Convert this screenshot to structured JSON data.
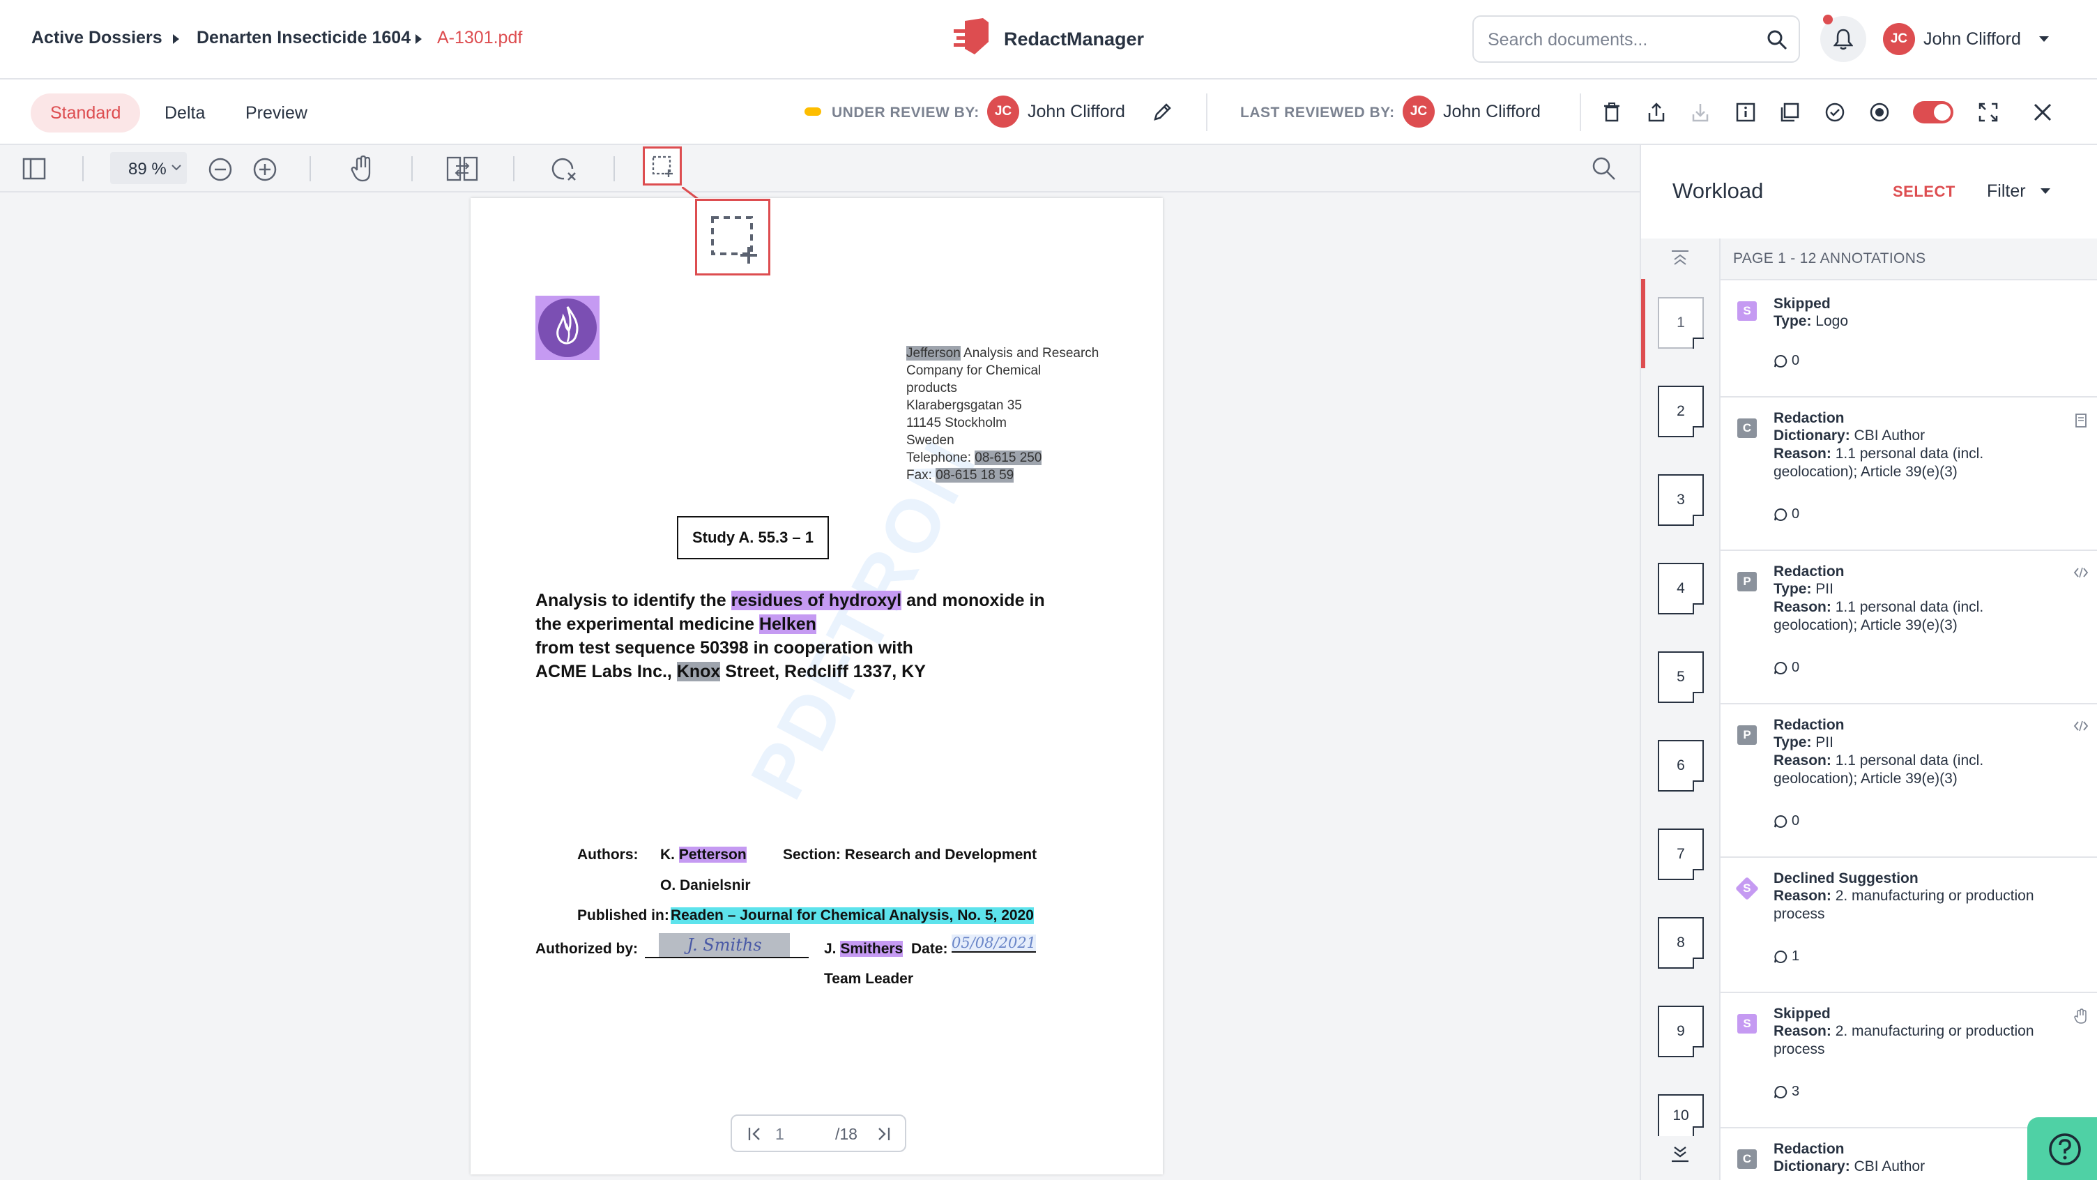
{
  "header": {
    "breadcrumbs": [
      "Active Dossiers",
      "Denarten Insecticide 1604",
      "A-1301.pdf"
    ],
    "brand": "RedactManager",
    "search_placeholder": "Search documents...",
    "user": {
      "initials": "JC",
      "name": "John Clifford"
    }
  },
  "toolbar": {
    "tabs": [
      "Standard",
      "Delta",
      "Preview"
    ],
    "active_tab": "Standard",
    "under_review_label": "UNDER REVIEW BY:",
    "under_review_user": {
      "initials": "JC",
      "name": "John Clifford"
    },
    "last_reviewed_label": "LAST REVIEWED BY:",
    "last_reviewed_user": {
      "initials": "JC",
      "name": "John Clifford"
    },
    "accent_color": "#dd4d50",
    "review_status_color": "#fdbd00"
  },
  "viewer": {
    "zoom": "89 %",
    "icons": [
      "sidebar-toggle-icon",
      "zoom-out-icon",
      "zoom-in-icon",
      "pan-hand-icon",
      "compare-icon",
      "clear-search-icon",
      "rectangle-select-icon",
      "search-icon"
    ]
  },
  "document": {
    "address_lines": [
      [
        "Jefferson",
        " Analysis and Research"
      ],
      [
        "Company for Chemical",
        ""
      ],
      [
        "products",
        ""
      ],
      [
        "Klarabergsgatan 35",
        ""
      ],
      [
        "11145 Stockholm",
        ""
      ],
      [
        "Sweden",
        ""
      ],
      [
        "Telephone: ",
        "08-615 250"
      ],
      [
        "Fax: ",
        "08-615 18 59"
      ]
    ],
    "study_box": "Study A. 55.3 – 1",
    "title_parts": {
      "l1a": "Analysis to identify the ",
      "l1b": "residues of hydroxyl",
      "l1c": " and monoxide in",
      "l2a": "the experimental medicine ",
      "l2b": "Helken",
      "l3": "from test sequence 50398 in cooperation with",
      "l4a": "ACME Labs Inc., ",
      "l4b": "Knox",
      "l4c": " Street, Redcliff 1337, KY"
    },
    "authors_label": "Authors:",
    "author1_prefix": "K. ",
    "author1_name": "Petterson",
    "author2": "O. Danielsnir",
    "section": "Section: Research and Development",
    "published_label": "Published in: ",
    "published_value": "Readen – Journal for Chemical Analysis, No. 5, 2020",
    "authorized_label": "Authorized by:",
    "signer_prefix": "J. ",
    "signer_name": "Smithers",
    "date_label": "Date:",
    "date_value": "05/08/2021",
    "signature_text": "J. Smiths",
    "team_leader": "Team Leader",
    "watermark": "PDFTRON",
    "current_page": "1",
    "total_pages": "/18"
  },
  "workload": {
    "title": "Workload",
    "select": "SELECT",
    "filter": "Filter",
    "page_header": "PAGE 1 - 12 ANNOTATIONS",
    "thumbnails": [
      "1",
      "2",
      "3",
      "4",
      "5",
      "6",
      "7",
      "8",
      "9",
      "10"
    ],
    "annotations": [
      {
        "badge": "S",
        "badge_style": "purple",
        "title": "Skipped",
        "lines": [
          [
            "Type:",
            " Logo"
          ]
        ],
        "comments": "0",
        "side_icon": ""
      },
      {
        "badge": "C",
        "badge_style": "grey",
        "title": "Redaction",
        "lines": [
          [
            "Dictionary:",
            " CBI Author"
          ],
          [
            "Reason:",
            " 1.1 personal data (incl."
          ],
          [
            "",
            "geolocation); Article 39(e)(3)"
          ]
        ],
        "comments": "0",
        "side_icon": "dictionary-icon"
      },
      {
        "badge": "P",
        "badge_style": "grey",
        "title": "Redaction",
        "lines": [
          [
            "Type:",
            " PII"
          ],
          [
            "Reason:",
            " 1.1 personal data (incl."
          ],
          [
            "",
            "geolocation); Article 39(e)(3)"
          ]
        ],
        "comments": "0",
        "side_icon": "code-icon"
      },
      {
        "badge": "P",
        "badge_style": "grey",
        "title": "Redaction",
        "lines": [
          [
            "Type:",
            " PII"
          ],
          [
            "Reason:",
            " 1.1 personal data (incl."
          ],
          [
            "",
            "geolocation); Article 39(e)(3)"
          ]
        ],
        "comments": "0",
        "side_icon": "code-icon"
      },
      {
        "badge": "S",
        "badge_style": "diamond",
        "title": "Declined Suggestion",
        "lines": [
          [
            "Reason:",
            " 2. manufacturing or production"
          ],
          [
            "",
            "process"
          ]
        ],
        "comments": "1",
        "side_icon": ""
      },
      {
        "badge": "S",
        "badge_style": "purple",
        "title": "Skipped",
        "lines": [
          [
            "Reason:",
            " 2. manufacturing or production"
          ],
          [
            "",
            "process"
          ]
        ],
        "comments": "3",
        "side_icon": "hand-icon"
      },
      {
        "badge": "C",
        "badge_style": "grey",
        "title": "Redaction",
        "lines": [
          [
            "Dictionary:",
            " CBI Author"
          ]
        ],
        "comments": "",
        "side_icon": ""
      }
    ]
  }
}
